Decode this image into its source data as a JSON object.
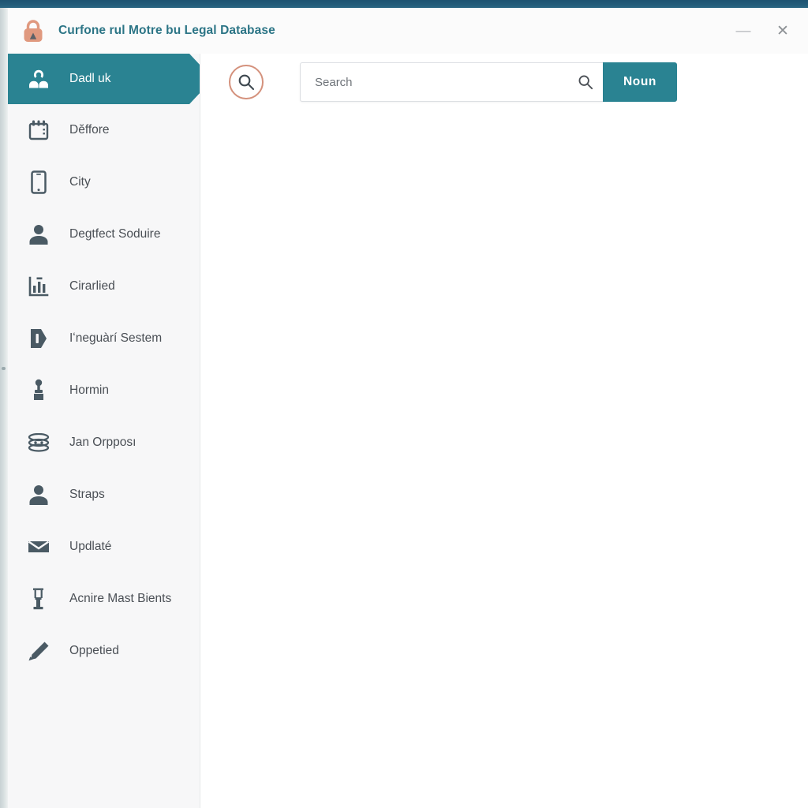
{
  "window": {
    "title": "Curfone rul Motre bu Legal Database",
    "title_icon": "lock-icon",
    "minimize_label": "—",
    "close_label": "✕",
    "accent_teal": "#2a8392",
    "accent_coral": "#d4917c",
    "titlebar_text_color": "#2c7586",
    "topstrip_color": "#1d5371",
    "sidebar_bg": "#f7f7f8",
    "content_bg": "#ffffff"
  },
  "sidebar": {
    "items": [
      {
        "label": "Dadl uk",
        "icon": "users-group-icon",
        "active": true
      },
      {
        "label": "Dĕffore",
        "icon": "calendar-icon",
        "active": false
      },
      {
        "label": "City",
        "icon": "mobile-phone-icon",
        "active": false
      },
      {
        "label": "Degtfect Soduire",
        "icon": "person-icon",
        "active": false
      },
      {
        "label": "Cirarlied",
        "icon": "bar-chart-icon",
        "active": false
      },
      {
        "label": "Iʻneguàrí Sestem",
        "icon": "tag-icon",
        "active": false
      },
      {
        "label": "Hormin",
        "icon": "trophy-icon",
        "active": false
      },
      {
        "label": "Jan Orpposı",
        "icon": "stacked-disc-icon",
        "active": false
      },
      {
        "label": "Straps",
        "icon": "person-icon",
        "active": false
      },
      {
        "label": "Updlaté",
        "icon": "envelope-icon",
        "active": false
      },
      {
        "label": "Acnire Mast Bients",
        "icon": "tower-icon",
        "active": false
      },
      {
        "label": "Oppetied",
        "icon": "pencil-icon",
        "active": false
      }
    ]
  },
  "toolbar": {
    "round_search_icon": "search-circle-icon",
    "search": {
      "value": "",
      "placeholder": "Search",
      "inline_icon": "search-icon"
    },
    "submit_label": "Noun"
  }
}
